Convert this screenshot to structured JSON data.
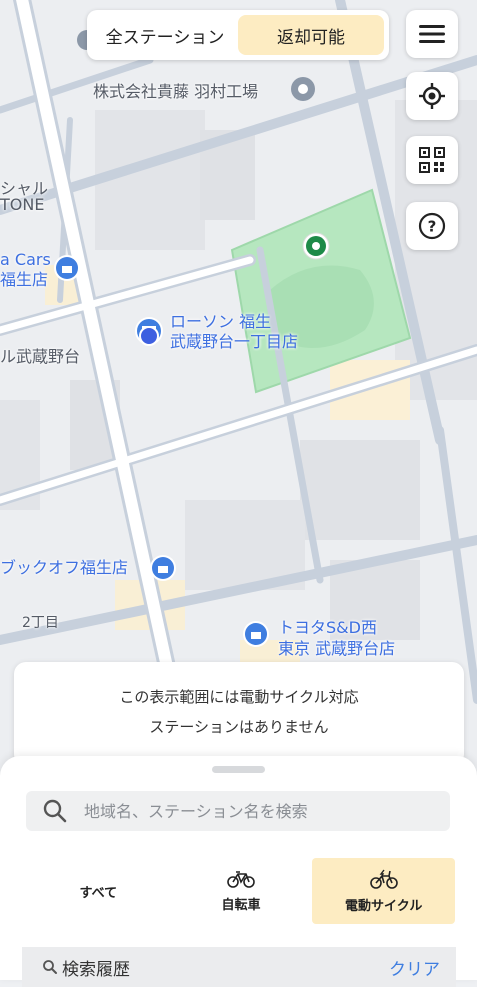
{
  "filter": {
    "all_label": "全ステーション",
    "returnable_label": "返却可能",
    "active": "returnable"
  },
  "controls": {
    "menu_icon": "hamburger-icon",
    "locate_icon": "crosshair-icon",
    "qr_icon": "qr-code-icon",
    "help_icon": "question-icon"
  },
  "map": {
    "labels": {
      "company": "株式会社貴藤 羽村工場",
      "shal": "シャル",
      "tone": "TONE",
      "cars1": "a Cars",
      "cars2": "福生店",
      "musashino": "ル武蔵野台",
      "lawson1": "ローソン 福生",
      "lawson2": "武蔵野台一丁目店",
      "bookoff": "ブックオフ福生店",
      "chome": "2丁目",
      "toyota1": "トヨタS&D西",
      "toyota2": "東京 武蔵野台店"
    }
  },
  "notice": {
    "line1": "この表示範囲には電動サイクル対応",
    "line2": "ステーションはありません"
  },
  "sheet": {
    "search_placeholder": "地域名、ステーション名を検索",
    "tabs": [
      {
        "label": "すべて",
        "icon": ""
      },
      {
        "label": "自転車",
        "icon": "bicycle-icon"
      },
      {
        "label": "電動サイクル",
        "icon": "e-bike-icon"
      }
    ],
    "active_tab": "電動サイクル",
    "history_label": "検索履歴",
    "clear_label": "クリア"
  },
  "colors": {
    "accent_yellow": "#fdecc2",
    "link_blue": "#3f7ee0",
    "park_green": "#b6e7bf",
    "road": "#c7d0dc"
  }
}
